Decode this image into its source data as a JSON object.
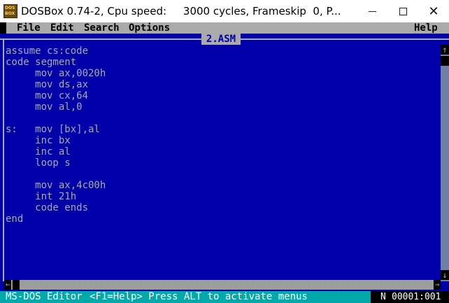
{
  "window": {
    "title": "DOSBox 0.74-2, Cpu speed:     3000 cycles, Frameskip  0, P...",
    "icon_text": [
      "DOS",
      "BOX"
    ],
    "close_glyph": "✕"
  },
  "menubar": {
    "items": [
      "File",
      "Edit",
      "Search",
      "Options"
    ],
    "help": "Help"
  },
  "editor": {
    "file_name": "2.ASM",
    "code": "assume cs:code\ncode segment\n     mov ax,0020h\n     mov ds,ax\n     mov cx,64\n     mov al,0\n\ns:   mov [bx],al\n     inc bx\n     inc al\n     loop s\n\n     mov ax,4c00h\n     int 21h\n     code ends\nend"
  },
  "scrollbar": {
    "up": "↑",
    "down": "↓",
    "left": "←",
    "right": "→"
  },
  "statusbar": {
    "app": "MS-DOS Editor",
    "hint": "<F1=Help> Press ALT to activate menus",
    "mode": "N",
    "position": "00001:001"
  },
  "colors": {
    "background": "#0000aa",
    "menu": "#aaaaaa",
    "status": "#00aaaa",
    "text": "#aaaaaa"
  }
}
